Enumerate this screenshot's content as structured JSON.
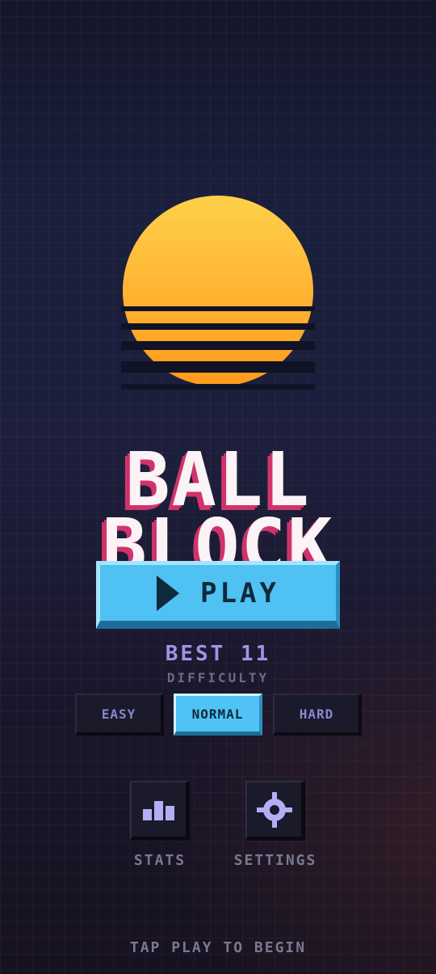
{
  "title": {
    "line1": "BALL",
    "line2": "BLOCK"
  },
  "play_button": {
    "label": "PLAY"
  },
  "best": {
    "label": "BEST",
    "value": "11"
  },
  "difficulty": {
    "label": "DIFFICULTY",
    "options": [
      "EASY",
      "NORMAL",
      "HARD"
    ],
    "selected": "NORMAL"
  },
  "menu": {
    "stats_label": "STATS",
    "settings_label": "SETTINGS"
  },
  "footer_hint": "TAP PLAY TO BEGIN",
  "colors": {
    "accent": "#4fc1f2",
    "title_shadow": "#d0336b",
    "sun_top": "#ffd04a",
    "sun_bottom": "#ff9a1c",
    "muted_text": "#7a7892",
    "best_text": "#9d95e2"
  },
  "icons": {
    "play": "play-triangle-icon",
    "stats": "bar-chart-icon",
    "settings": "crosshair-gear-icon"
  }
}
